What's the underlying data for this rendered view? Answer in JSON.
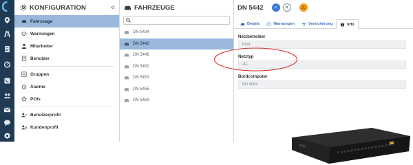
{
  "colors": {
    "rail": "#1f3a52",
    "active_row": "#9ab8dc",
    "accent_blue": "#3a7bd5",
    "alert_orange": "#f39c12",
    "annotation": "#d83a3a"
  },
  "rail": {
    "icons": [
      "logo-icon",
      "location-pin-icon",
      "route-icon",
      "document-icon",
      "stopwatch-icon",
      "phone-icon",
      "users-icon",
      "mail-icon",
      "chat-icon",
      "settings-icon"
    ]
  },
  "konfig": {
    "title": "KONFIGURATION",
    "collapse": "«",
    "items": [
      {
        "label": "Fahrzeuge",
        "icon": "car-icon",
        "active": true
      },
      {
        "label": "Warnungen",
        "icon": "warning-icon"
      },
      {
        "label": "Mitarbeiter",
        "icon": "employee-icon"
      },
      {
        "label": "Benutzer",
        "icon": "user-icon"
      },
      {
        "label": "Gruppen",
        "icon": "group-icon"
      },
      {
        "label": "Alarme",
        "icon": "alarm-icon"
      },
      {
        "label": "POIs",
        "icon": "star-icon"
      },
      {
        "label": "Benutzerprofil",
        "icon": "user-profile-icon"
      },
      {
        "label": "Kundenprofil",
        "icon": "customer-profile-icon"
      }
    ]
  },
  "fahrzeuge": {
    "title": "FAHRZEUGE",
    "search_placeholder": "",
    "vehicles": [
      "DN 5434",
      "DN 5442",
      "DN 5446",
      "DN 5452",
      "DN 5453",
      "DN 5455",
      "DN 5459"
    ],
    "selected": "DN 5442"
  },
  "detail": {
    "title": "DN 5442",
    "check": "✓",
    "cross": "✕",
    "alert": "⚠",
    "tabs": [
      {
        "label": "Details",
        "icon": "car-icon"
      },
      {
        "label": "Warnungen",
        "icon": "warning-icon"
      },
      {
        "label": "Versicherung",
        "icon": "handshake-icon"
      },
      {
        "label": "Info",
        "icon": "info-icon",
        "active": true
      }
    ],
    "fields": [
      {
        "label": "Netzbetreiber",
        "value": "Post"
      },
      {
        "label": "Netztyp",
        "value": "2G"
      },
      {
        "label": "Bordcomputer",
        "value": "NO 8009"
      }
    ]
  }
}
